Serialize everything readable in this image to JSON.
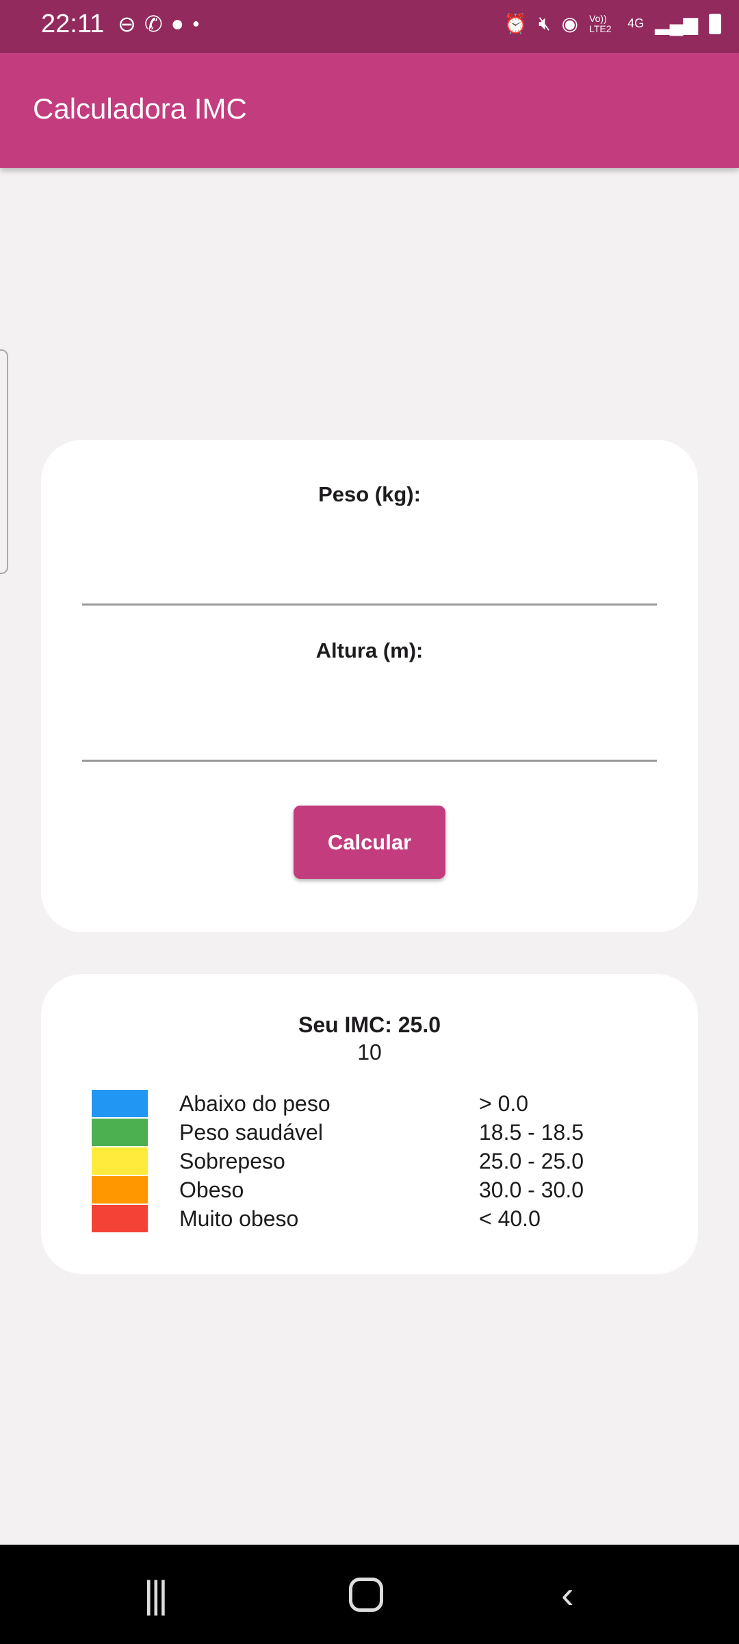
{
  "status_bar": {
    "time": "22:11",
    "left_icons": [
      "dnd-icon",
      "whatsapp-icon",
      "app-icon",
      "dot-icon"
    ],
    "right_icons": [
      "alarm-icon",
      "mute-icon",
      "hotspot-icon",
      "volte-icon",
      "4g-icon",
      "signal-icon",
      "battery-charging-icon"
    ],
    "volte": "Vo)) LTE2",
    "net": "4G"
  },
  "app_bar": {
    "title": "Calculadora IMC",
    "color": "#c23c7e"
  },
  "form": {
    "weight_label": "Peso (kg):",
    "weight_value": "",
    "height_label": "Altura (m):",
    "height_value": "",
    "button": "Calcular"
  },
  "result": {
    "imc_text": "Seu IMC: 25.0",
    "value": "10",
    "legend": [
      {
        "label": "Abaixo do peso",
        "range": "> 0.0",
        "color": "#2196f3"
      },
      {
        "label": "Peso saudável",
        "range": "18.5 - 18.5",
        "color": "#4caf50"
      },
      {
        "label": "Sobrepeso",
        "range": "25.0 - 25.0",
        "color": "#ffeb3b"
      },
      {
        "label": "Obeso",
        "range": "30.0 - 30.0",
        "color": "#ff9800"
      },
      {
        "label": "Muito obeso",
        "range": "< 40.0",
        "color": "#f44336"
      }
    ]
  }
}
